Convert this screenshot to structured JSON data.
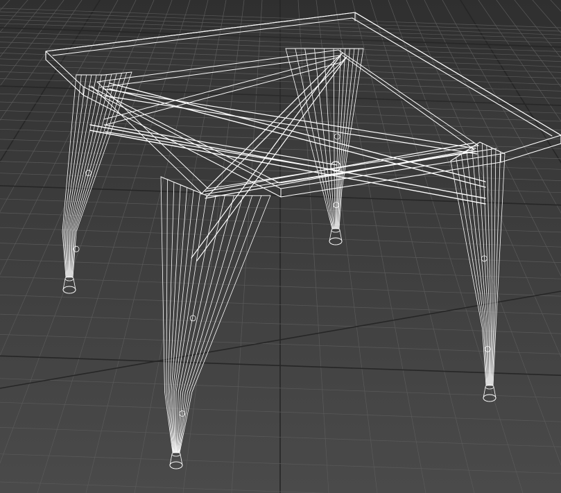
{
  "viewport": {
    "mode": "wireframe",
    "background_color": "#3b3b3b",
    "grid_color": "#5a5a5a",
    "grid_major_color": "#262626",
    "wire_color": "#ffffff"
  },
  "scene": {
    "object": "table-wireframe-model",
    "legs": 4,
    "has_cross_braces": true
  }
}
